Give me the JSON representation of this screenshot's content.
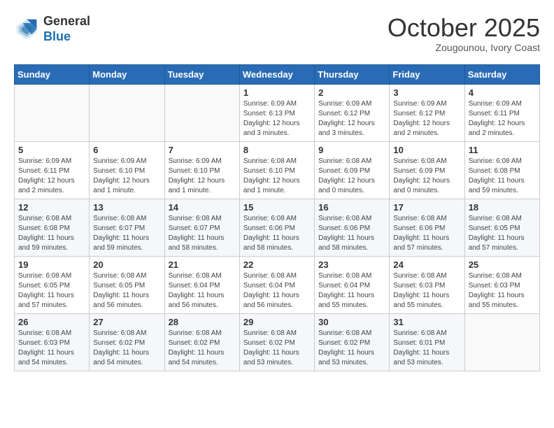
{
  "header": {
    "logo_line1": "General",
    "logo_line2": "Blue",
    "month": "October 2025",
    "location": "Zougounou, Ivory Coast"
  },
  "weekdays": [
    "Sunday",
    "Monday",
    "Tuesday",
    "Wednesday",
    "Thursday",
    "Friday",
    "Saturday"
  ],
  "weeks": [
    [
      {
        "day": "",
        "info": ""
      },
      {
        "day": "",
        "info": ""
      },
      {
        "day": "",
        "info": ""
      },
      {
        "day": "1",
        "info": "Sunrise: 6:09 AM\nSunset: 6:13 PM\nDaylight: 12 hours and 3 minutes."
      },
      {
        "day": "2",
        "info": "Sunrise: 6:09 AM\nSunset: 6:12 PM\nDaylight: 12 hours and 3 minutes."
      },
      {
        "day": "3",
        "info": "Sunrise: 6:09 AM\nSunset: 6:12 PM\nDaylight: 12 hours and 2 minutes."
      },
      {
        "day": "4",
        "info": "Sunrise: 6:09 AM\nSunset: 6:11 PM\nDaylight: 12 hours and 2 minutes."
      }
    ],
    [
      {
        "day": "5",
        "info": "Sunrise: 6:09 AM\nSunset: 6:11 PM\nDaylight: 12 hours and 2 minutes."
      },
      {
        "day": "6",
        "info": "Sunrise: 6:09 AM\nSunset: 6:10 PM\nDaylight: 12 hours and 1 minute."
      },
      {
        "day": "7",
        "info": "Sunrise: 6:09 AM\nSunset: 6:10 PM\nDaylight: 12 hours and 1 minute."
      },
      {
        "day": "8",
        "info": "Sunrise: 6:08 AM\nSunset: 6:10 PM\nDaylight: 12 hours and 1 minute."
      },
      {
        "day": "9",
        "info": "Sunrise: 6:08 AM\nSunset: 6:09 PM\nDaylight: 12 hours and 0 minutes."
      },
      {
        "day": "10",
        "info": "Sunrise: 6:08 AM\nSunset: 6:09 PM\nDaylight: 12 hours and 0 minutes."
      },
      {
        "day": "11",
        "info": "Sunrise: 6:08 AM\nSunset: 6:08 PM\nDaylight: 11 hours and 59 minutes."
      }
    ],
    [
      {
        "day": "12",
        "info": "Sunrise: 6:08 AM\nSunset: 6:08 PM\nDaylight: 11 hours and 59 minutes."
      },
      {
        "day": "13",
        "info": "Sunrise: 6:08 AM\nSunset: 6:07 PM\nDaylight: 11 hours and 59 minutes."
      },
      {
        "day": "14",
        "info": "Sunrise: 6:08 AM\nSunset: 6:07 PM\nDaylight: 11 hours and 58 minutes."
      },
      {
        "day": "15",
        "info": "Sunrise: 6:08 AM\nSunset: 6:06 PM\nDaylight: 11 hours and 58 minutes."
      },
      {
        "day": "16",
        "info": "Sunrise: 6:08 AM\nSunset: 6:06 PM\nDaylight: 11 hours and 58 minutes."
      },
      {
        "day": "17",
        "info": "Sunrise: 6:08 AM\nSunset: 6:06 PM\nDaylight: 11 hours and 57 minutes."
      },
      {
        "day": "18",
        "info": "Sunrise: 6:08 AM\nSunset: 6:05 PM\nDaylight: 11 hours and 57 minutes."
      }
    ],
    [
      {
        "day": "19",
        "info": "Sunrise: 6:08 AM\nSunset: 6:05 PM\nDaylight: 11 hours and 57 minutes."
      },
      {
        "day": "20",
        "info": "Sunrise: 6:08 AM\nSunset: 6:05 PM\nDaylight: 11 hours and 56 minutes."
      },
      {
        "day": "21",
        "info": "Sunrise: 6:08 AM\nSunset: 6:04 PM\nDaylight: 11 hours and 56 minutes."
      },
      {
        "day": "22",
        "info": "Sunrise: 6:08 AM\nSunset: 6:04 PM\nDaylight: 11 hours and 56 minutes."
      },
      {
        "day": "23",
        "info": "Sunrise: 6:08 AM\nSunset: 6:04 PM\nDaylight: 11 hours and 55 minutes."
      },
      {
        "day": "24",
        "info": "Sunrise: 6:08 AM\nSunset: 6:03 PM\nDaylight: 11 hours and 55 minutes."
      },
      {
        "day": "25",
        "info": "Sunrise: 6:08 AM\nSunset: 6:03 PM\nDaylight: 11 hours and 55 minutes."
      }
    ],
    [
      {
        "day": "26",
        "info": "Sunrise: 6:08 AM\nSunset: 6:03 PM\nDaylight: 11 hours and 54 minutes."
      },
      {
        "day": "27",
        "info": "Sunrise: 6:08 AM\nSunset: 6:02 PM\nDaylight: 11 hours and 54 minutes."
      },
      {
        "day": "28",
        "info": "Sunrise: 6:08 AM\nSunset: 6:02 PM\nDaylight: 11 hours and 54 minutes."
      },
      {
        "day": "29",
        "info": "Sunrise: 6:08 AM\nSunset: 6:02 PM\nDaylight: 11 hours and 53 minutes."
      },
      {
        "day": "30",
        "info": "Sunrise: 6:08 AM\nSunset: 6:02 PM\nDaylight: 11 hours and 53 minutes."
      },
      {
        "day": "31",
        "info": "Sunrise: 6:08 AM\nSunset: 6:01 PM\nDaylight: 11 hours and 53 minutes."
      },
      {
        "day": "",
        "info": ""
      }
    ]
  ]
}
